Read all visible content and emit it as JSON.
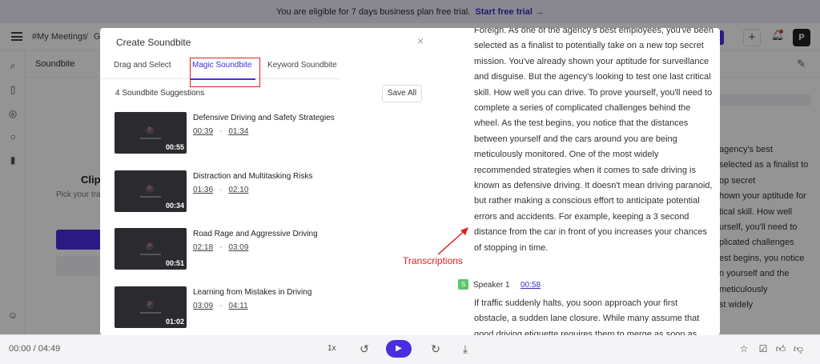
{
  "banner": {
    "text": "You are eligible for 7 days business plan free trial.",
    "link": "Start free trial →"
  },
  "topbar": {
    "crumb": "#My Meetings",
    "crumb_sep": "/",
    "crumb2": "G",
    "avatar": "P",
    "plus": "+"
  },
  "subheader": {
    "title": "Soundbite"
  },
  "background": {
    "clip_title": "Clip o",
    "pick_text": "Pick your tra",
    "transcript_lines": [
      "agency's best",
      "selected as a finalist to",
      "op secret",
      "hown your aptitude for",
      "tical skill. How well",
      "urself, you'll need to",
      "plicated challenges",
      "est begins, you notice",
      "n yourself and the",
      "meticulously",
      "st widely"
    ]
  },
  "player": {
    "time": "00:00 / 04:49",
    "speed": "1x"
  },
  "modal": {
    "title": "Create Soundbite",
    "close": "×",
    "tabs": [
      "Drag and Select",
      "Magic Soundbite",
      "Keyword Soundbite"
    ],
    "active_tab": "Magic Soundbite",
    "suggestion_count": "4 Soundbite Suggestions",
    "save_all": "Save All",
    "soundbites": [
      {
        "title": "Defensive Driving and Safety Strategies",
        "start": "00:39",
        "end": "01:34",
        "duration": "00:55"
      },
      {
        "title": "Distraction and Multitasking Risks",
        "start": "01:36",
        "end": "02:10",
        "duration": "00:34"
      },
      {
        "title": "Road Rage and Aggressive Driving",
        "start": "02:18",
        "end": "03:09",
        "duration": "00:51"
      },
      {
        "title": "Learning from Mistakes in Driving",
        "start": "03:09",
        "end": "04:11",
        "duration": "01:02"
      }
    ],
    "transcript": {
      "paragraph1": "Foreign. As one of the agency's best employees, you've been selected as a finalist to potentially take on a new top secret mission. You've already shown your aptitude for surveillance and disguise. But the agency's looking to test one last critical skill. How well you can drive. To prove yourself, you'll need to complete a series of complicated challenges behind the wheel. As the test begins, you notice that the distances between yourself and the cars around you are being meticulously monitored. One of the most widely recommended strategies when it comes to safe driving is known as defensive driving. It doesn't mean driving paranoid, but rather making a conscious effort to anticipate potential errors and accidents. For example, keeping a 3 second distance from the car in front of you increases your chances of stopping in time.",
      "speaker_badge": "S",
      "speaker_name": "Speaker 1",
      "speaker_time": "00:58",
      "paragraph2": "If traffic suddenly halts, you soon approach your first obstacle, a sudden lane closure. While many assume that good driving etiquette requires them to merge as soon as"
    },
    "annotation": "Transcriptions"
  },
  "colors": {
    "accent": "#4b2ee0",
    "annotation": "#e02020",
    "speaker": "#5fc46a"
  }
}
